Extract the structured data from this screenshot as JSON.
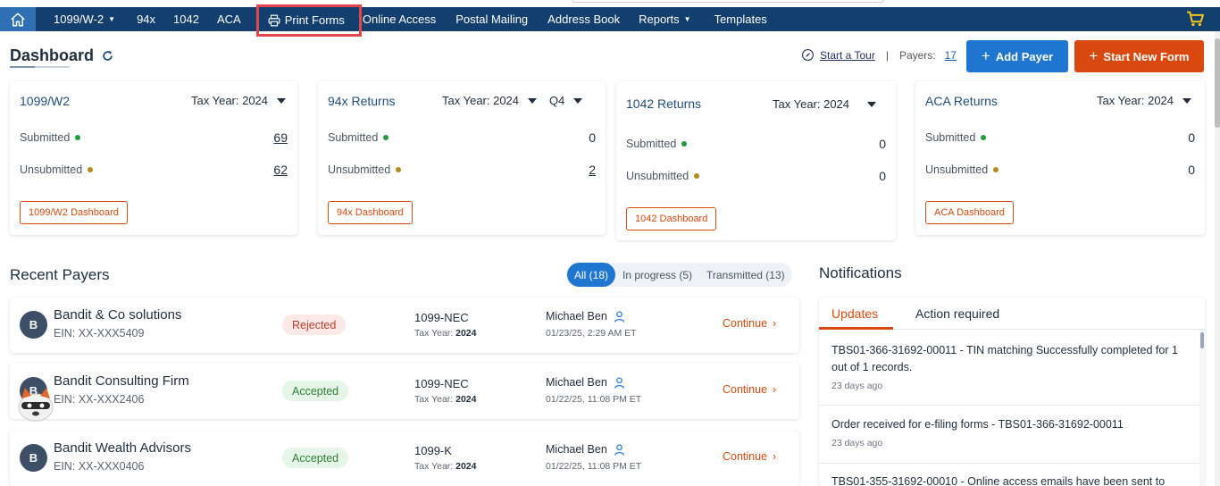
{
  "nav": {
    "items": [
      {
        "label": "1099/W-2",
        "dropdown": true
      },
      {
        "label": "94x",
        "dropdown": false
      },
      {
        "label": "1042",
        "dropdown": false
      },
      {
        "label": "ACA",
        "dropdown": false
      },
      {
        "label": "Print Forms",
        "dropdown": false
      },
      {
        "label": "Online Access",
        "dropdown": false
      },
      {
        "label": "Postal Mailing",
        "dropdown": false
      },
      {
        "label": "Address Book",
        "dropdown": false
      },
      {
        "label": "Reports",
        "dropdown": true
      },
      {
        "label": "Templates",
        "dropdown": false
      }
    ],
    "colors": {
      "bar": "#123f6e",
      "home": "#2f6fb4",
      "highlight": "#e2464c",
      "cart": "#f5c518"
    }
  },
  "header": {
    "title": "Dashboard",
    "tour_label": "Start a Tour",
    "separator": "|",
    "payers_label": "Payers:",
    "payers_count": "17",
    "add_payer_label": "Add Payer",
    "start_new_form_label": "Start New Form"
  },
  "cards": [
    {
      "title": "1099/W2",
      "tax_year": "Tax Year: 2024",
      "quarter": "",
      "submitted_label": "Submitted",
      "submitted_value": "69",
      "unsubmitted_label": "Unsubmitted",
      "unsubmitted_value": "62",
      "button": "1099/W2 Dashboard"
    },
    {
      "title": "94x Returns",
      "tax_year": "Tax Year: 2024",
      "quarter": "Q4",
      "submitted_label": "Submitted",
      "submitted_value": "0",
      "unsubmitted_label": "Unsubmitted",
      "unsubmitted_value": "2",
      "button": "94x Dashboard"
    },
    {
      "title": "1042 Returns",
      "tax_year": "Tax Year: 2024",
      "quarter": "",
      "submitted_label": "Submitted",
      "submitted_value": "0",
      "unsubmitted_label": "Unsubmitted",
      "unsubmitted_value": "0",
      "button": "1042 Dashboard"
    },
    {
      "title": "ACA Returns",
      "tax_year": "Tax Year: 2024",
      "quarter": "",
      "submitted_label": "Submitted",
      "submitted_value": "0",
      "unsubmitted_label": "Unsubmitted",
      "unsubmitted_value": "0",
      "button": "ACA Dashboard"
    }
  ],
  "status_colors": {
    "submitted": "#1f9d3a",
    "unsubmitted": "#b58a1a"
  },
  "recent": {
    "title": "Recent Payers",
    "filters": [
      {
        "label": "All (18)",
        "active": true
      },
      {
        "label": "In progress (5)",
        "active": false
      },
      {
        "label": "Transmitted (13)",
        "active": false
      }
    ],
    "payers": [
      {
        "initial": "B",
        "name": "Bandit & Co solutions",
        "ein": "EIN: XX-XXX5409",
        "status": "Rejected",
        "form": "1099-NEC",
        "tax_year_label": "Tax Year:",
        "tax_year": "2024",
        "user": "Michael Ben",
        "date": "01/23/25, 2:29 AM ET",
        "action": "Continue"
      },
      {
        "initial": "B",
        "name": "Bandit Consulting Firm",
        "ein": "EIN: XX-XXX2406",
        "status": "Accepted",
        "form": "1099-NEC",
        "tax_year_label": "Tax Year:",
        "tax_year": "2024",
        "user": "Michael Ben",
        "date": "01/22/25, 11:08 PM ET",
        "action": "Continue"
      },
      {
        "initial": "B",
        "name": "Bandit Wealth Advisors",
        "ein": "EIN: XX-XXX0406",
        "status": "Accepted",
        "form": "1099-K",
        "tax_year_label": "Tax Year:",
        "tax_year": "2024",
        "user": "Michael Ben",
        "date": "01/22/25, 11:08 PM ET",
        "action": "Continue"
      }
    ]
  },
  "notifications": {
    "title": "Notifications",
    "tabs": [
      "Updates",
      "Action required"
    ],
    "entries": [
      {
        "message": "TBS01-366-31692-00011 - TIN matching Successfully completed for 1 out of 1 records.",
        "when": "23 days ago"
      },
      {
        "message": "Order received for e-filing forms - TBS01-366-31692-00011",
        "when": "23 days ago"
      },
      {
        "message": "TBS01-355-31692-00010 - Online access emails have been sent to",
        "when": ""
      }
    ]
  }
}
